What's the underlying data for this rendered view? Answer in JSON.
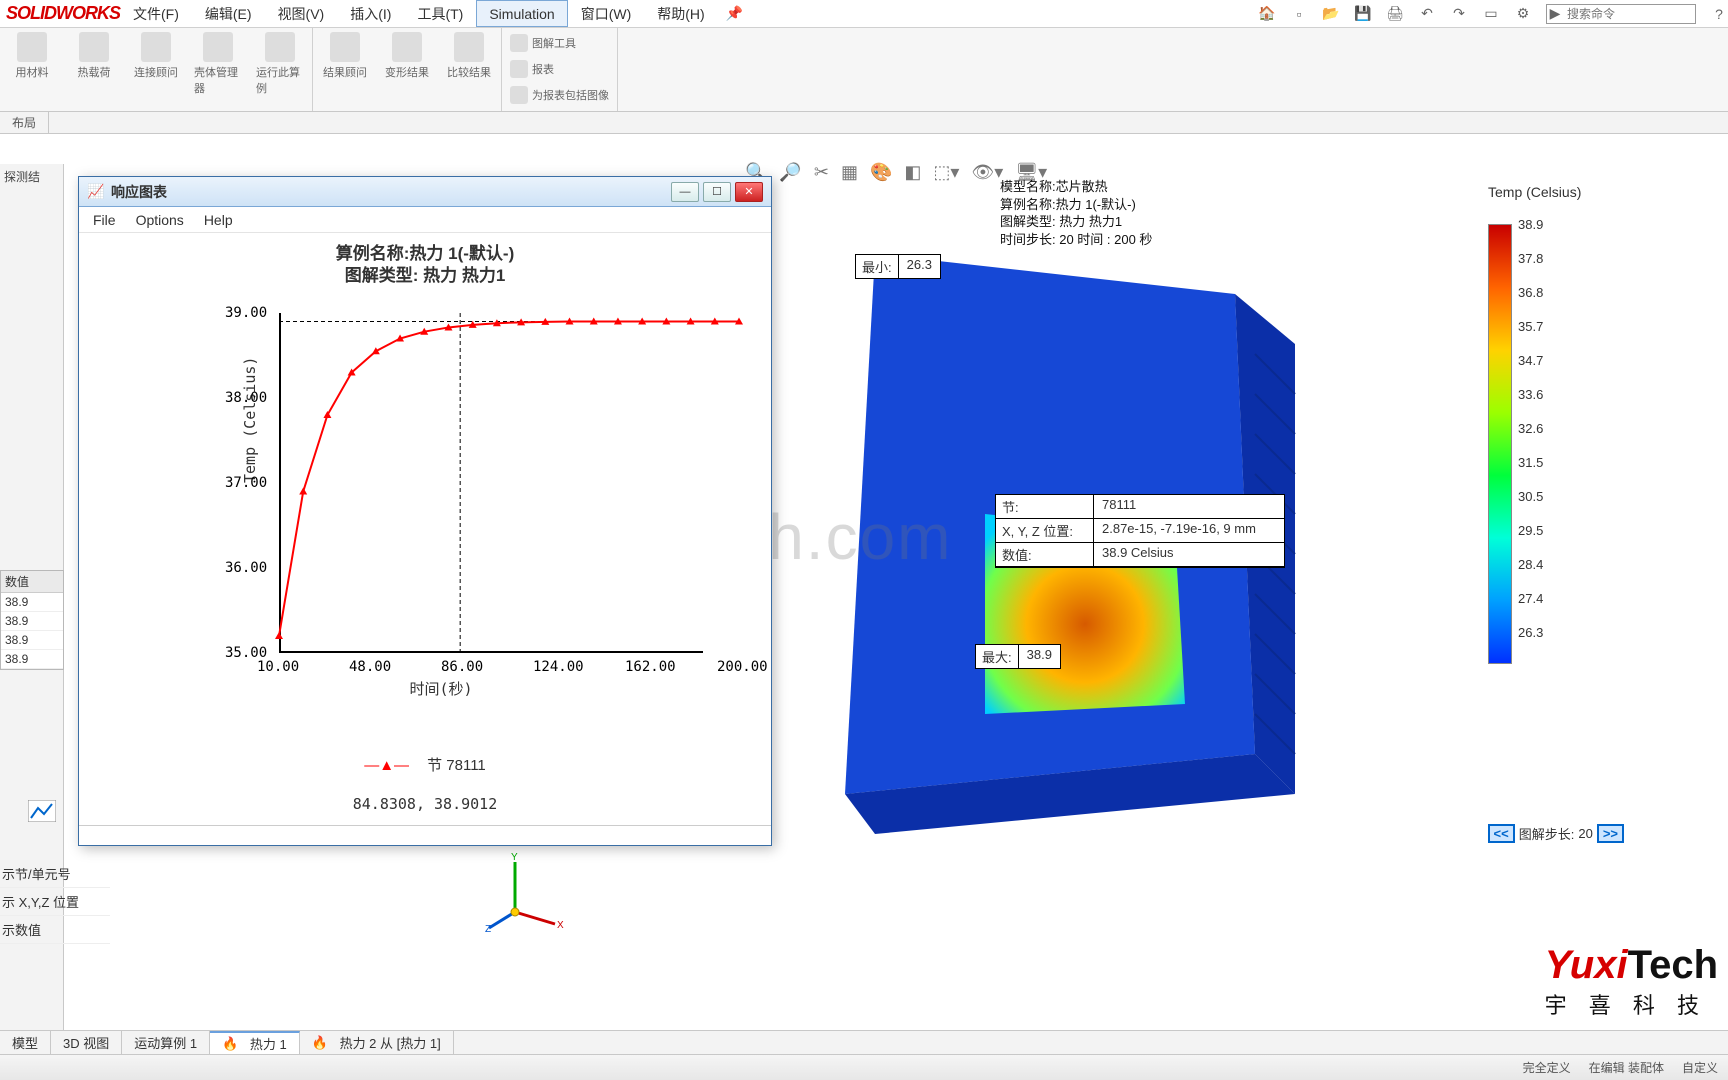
{
  "app": {
    "name": "SOLIDWORKS"
  },
  "menu": {
    "items": [
      "文件(F)",
      "编辑(E)",
      "视图(V)",
      "插入(I)",
      "工具(T)",
      "Simulation",
      "窗口(W)",
      "帮助(H)"
    ],
    "active_index": 5
  },
  "search": {
    "placeholder": "搜索命令"
  },
  "ribbon": {
    "group1": [
      "用材料",
      "热载荷",
      "连接顾问",
      "壳体管理器",
      "运行此算例"
    ],
    "group2": [
      "结果顾问",
      "变形结果",
      "比较结果"
    ],
    "group3_rows": [
      "图解工具",
      "报表",
      "为报表包括图像"
    ]
  },
  "tabstrip": {
    "items": [
      "布局"
    ]
  },
  "left_panel": {
    "label": "探测结"
  },
  "value_panel": {
    "header": "数值",
    "values": [
      "38.9",
      "38.9",
      "38.9",
      "38.9"
    ]
  },
  "options_list": [
    "示节/单元号",
    "示 X,Y,Z 位置",
    "示数值"
  ],
  "chart_window": {
    "title": "响应图表",
    "menu": [
      "File",
      "Options",
      "Help"
    ],
    "heading_line1": "算例名称:热力 1(-默认-)",
    "heading_line2": "图解类型: 热力 热力1",
    "ylabel": "Temp (Celsius)",
    "xlabel": "时间(秒)",
    "legend": "节 78111",
    "cursor_readout": "84.8308, 38.9012"
  },
  "chart_data": {
    "type": "line",
    "title": "算例名称:热力 1(-默认-)  图解类型: 热力 热力1",
    "xlabel": "时间(秒)",
    "ylabel": "Temp (Celsius)",
    "xlim": [
      10,
      200
    ],
    "ylim": [
      35,
      39
    ],
    "x_ticks": [
      10.0,
      48.0,
      86.0,
      124.0,
      162.0,
      200.0
    ],
    "y_ticks": [
      35.0,
      36.0,
      37.0,
      38.0,
      39.0
    ],
    "series": [
      {
        "name": "节 78111",
        "x": [
          10,
          20,
          30,
          40,
          50,
          60,
          70,
          80,
          90,
          100,
          110,
          120,
          130,
          140,
          150,
          160,
          170,
          180,
          190,
          200
        ],
        "y": [
          35.2,
          36.9,
          37.8,
          38.3,
          38.55,
          38.7,
          38.78,
          38.83,
          38.86,
          38.88,
          38.89,
          38.895,
          38.9,
          38.9,
          38.9,
          38.9,
          38.9,
          38.9,
          38.9,
          38.9
        ]
      }
    ],
    "cursor": {
      "x": 84.8308,
      "y": 38.9012
    }
  },
  "viewport_info": {
    "l1": "模型名称:芯片散热",
    "l2": "算例名称:热力 1(-默认-)",
    "l3": "图解类型: 热力 热力1",
    "l4": "时间步长: 20  时间 : 200 秒"
  },
  "callouts": {
    "min": {
      "label": "最小:",
      "value": "26.3"
    },
    "max": {
      "label": "最大:",
      "value": "38.9"
    }
  },
  "probe": {
    "rows": [
      {
        "k": "节:",
        "v": "78111"
      },
      {
        "k": "X, Y, Z 位置:",
        "v": "2.87e-15, -7.19e-16, 9 mm"
      },
      {
        "k": "数值:",
        "v": "38.9      Celsius"
      }
    ]
  },
  "color_legend": {
    "title": "Temp (Celsius)",
    "ticks": [
      "38.9",
      "37.8",
      "36.8",
      "35.7",
      "34.7",
      "33.6",
      "32.6",
      "31.5",
      "30.5",
      "29.5",
      "28.4",
      "27.4",
      "26.3"
    ]
  },
  "step_control": {
    "label": "图解步长:",
    "value": "20"
  },
  "watermark": "http://www.yuxitech.com",
  "brand": {
    "main1": "Yuxi",
    "main2": "Tech",
    "sub": "宇 喜 科 技"
  },
  "bottom_tabs": [
    "模型",
    "3D 视图",
    "运动算例 1",
    "热力 1",
    "热力 2 从 [热力 1]"
  ],
  "bottom_active_index": 3,
  "statusbar": {
    "right": [
      "完全定义",
      "在编辑 装配体",
      "自定义"
    ]
  }
}
